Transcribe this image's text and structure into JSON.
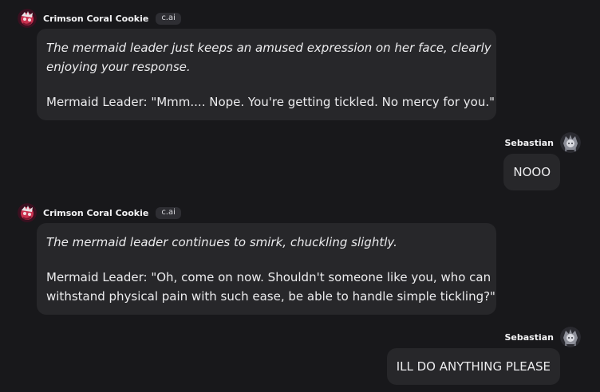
{
  "messages": [
    {
      "role": "bot",
      "name": "Crimson Coral Cookie",
      "badge": "c.ai",
      "italic": "The mermaid leader just keeps an amused expression on her face, clearly",
      "italic2": "enjoying your response.",
      "text": "Mermaid Leader: \"Mmm.... Nope. You're getting tickled. No mercy for you.\"",
      "text2": ""
    },
    {
      "role": "user",
      "name": "Sebastian",
      "text": "NOOO"
    },
    {
      "role": "bot",
      "name": "Crimson Coral Cookie",
      "badge": "c.ai",
      "italic": "The mermaid leader continues to smirk, chuckling slightly.",
      "italic2": "",
      "text": "Mermaid Leader: \"Oh, come on now. Shouldn't someone like you, who can",
      "text2": "withstand physical pain with such ease, be able to handle simple tickling?\""
    },
    {
      "role": "user",
      "name": "Sebastian",
      "text": "ILL DO ANYTHING PLEASE"
    }
  ],
  "icons": {
    "bot_avatar": "crimson-coral-cookie-avatar-icon",
    "user_avatar": "sebastian-avatar-icon"
  }
}
